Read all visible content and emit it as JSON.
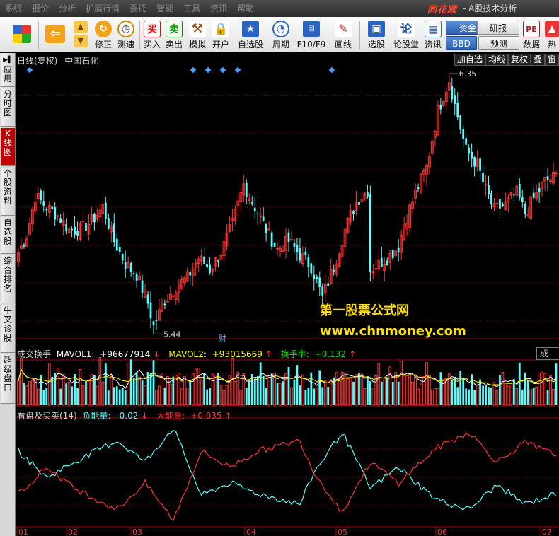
{
  "menubar": {
    "items": [
      "系统",
      "报价",
      "分析",
      "扩展行情",
      "委托",
      "智能",
      "工具",
      "资讯",
      "帮助"
    ],
    "brand": "同花顺",
    "title": "- A股技术分析"
  },
  "toolbar": {
    "buttons": [
      {
        "label": "修正",
        "icon": "refresh-icon"
      },
      {
        "label": "测速",
        "icon": "clock-icon"
      },
      {
        "label": "买入",
        "icon": "buy-icon",
        "glyph": "买"
      },
      {
        "label": "卖出",
        "icon": "sell-icon",
        "glyph": "卖"
      },
      {
        "label": "模拟",
        "icon": "hammer-icon"
      },
      {
        "label": "开户",
        "icon": "lock-icon"
      },
      {
        "label": "自选股",
        "icon": "star-icon"
      },
      {
        "label": "周期",
        "icon": "cycle-icon"
      },
      {
        "label": "F10/F9",
        "icon": "f10-icon"
      },
      {
        "label": "画线",
        "icon": "pencil-icon"
      },
      {
        "label": "选股",
        "icon": "monitor-icon"
      },
      {
        "label": "论股堂",
        "icon": "discuss-icon",
        "glyph": "论"
      },
      {
        "label": "资讯",
        "icon": "document-icon"
      },
      {
        "label": "数据",
        "icon": "pe-icon",
        "glyph": "PE"
      },
      {
        "label": "热",
        "icon": "hot-icon"
      }
    ],
    "side_buttons": [
      "资金",
      "研报",
      "BBD",
      "预测"
    ]
  },
  "left_tabs": [
    "应用",
    "分时图",
    "K线图",
    "个股资料",
    "自选股",
    "综合排名",
    "牛叉诊股",
    "超级盘口"
  ],
  "kline": {
    "period_label": "日线(复权)",
    "stock_name": "中国石化",
    "tabs": [
      "加自选",
      "均线",
      "复权",
      "叠",
      "窗"
    ],
    "high_label": "6.35",
    "low_label": "5.44",
    "fin_marker": "财"
  },
  "watermark": {
    "line1": "第一股票公式网",
    "line2": "www.chnmoney.com"
  },
  "volume_panel": {
    "name": "成交换手",
    "mavol1_label": "MAVOL1:",
    "mavol1_value": "+96677914",
    "mavol2_label": "MAVOL2:",
    "mavol2_value": "+93015669",
    "turnover_label": "换手率:",
    "turnover_value": "+0.132",
    "right_label": "成"
  },
  "indicator_panel": {
    "name": "看盘及买卖(14)",
    "neg_label": "负能量:",
    "neg_value": "-0.02",
    "pos_label": "大能量:",
    "pos_value": "+0.035"
  },
  "x_axis": {
    "months": [
      "01",
      "02",
      "03",
      "04",
      "05",
      "06",
      "07"
    ]
  },
  "colors": {
    "up": "#ff3232",
    "down": "#54ffff",
    "mavol1": "#ffffff",
    "mavol2": "#ffff00",
    "turnover": "#1fd11f",
    "neg_line": "#54ffff",
    "pos_line": "#ff3232",
    "grid": "#8b0000"
  }
}
